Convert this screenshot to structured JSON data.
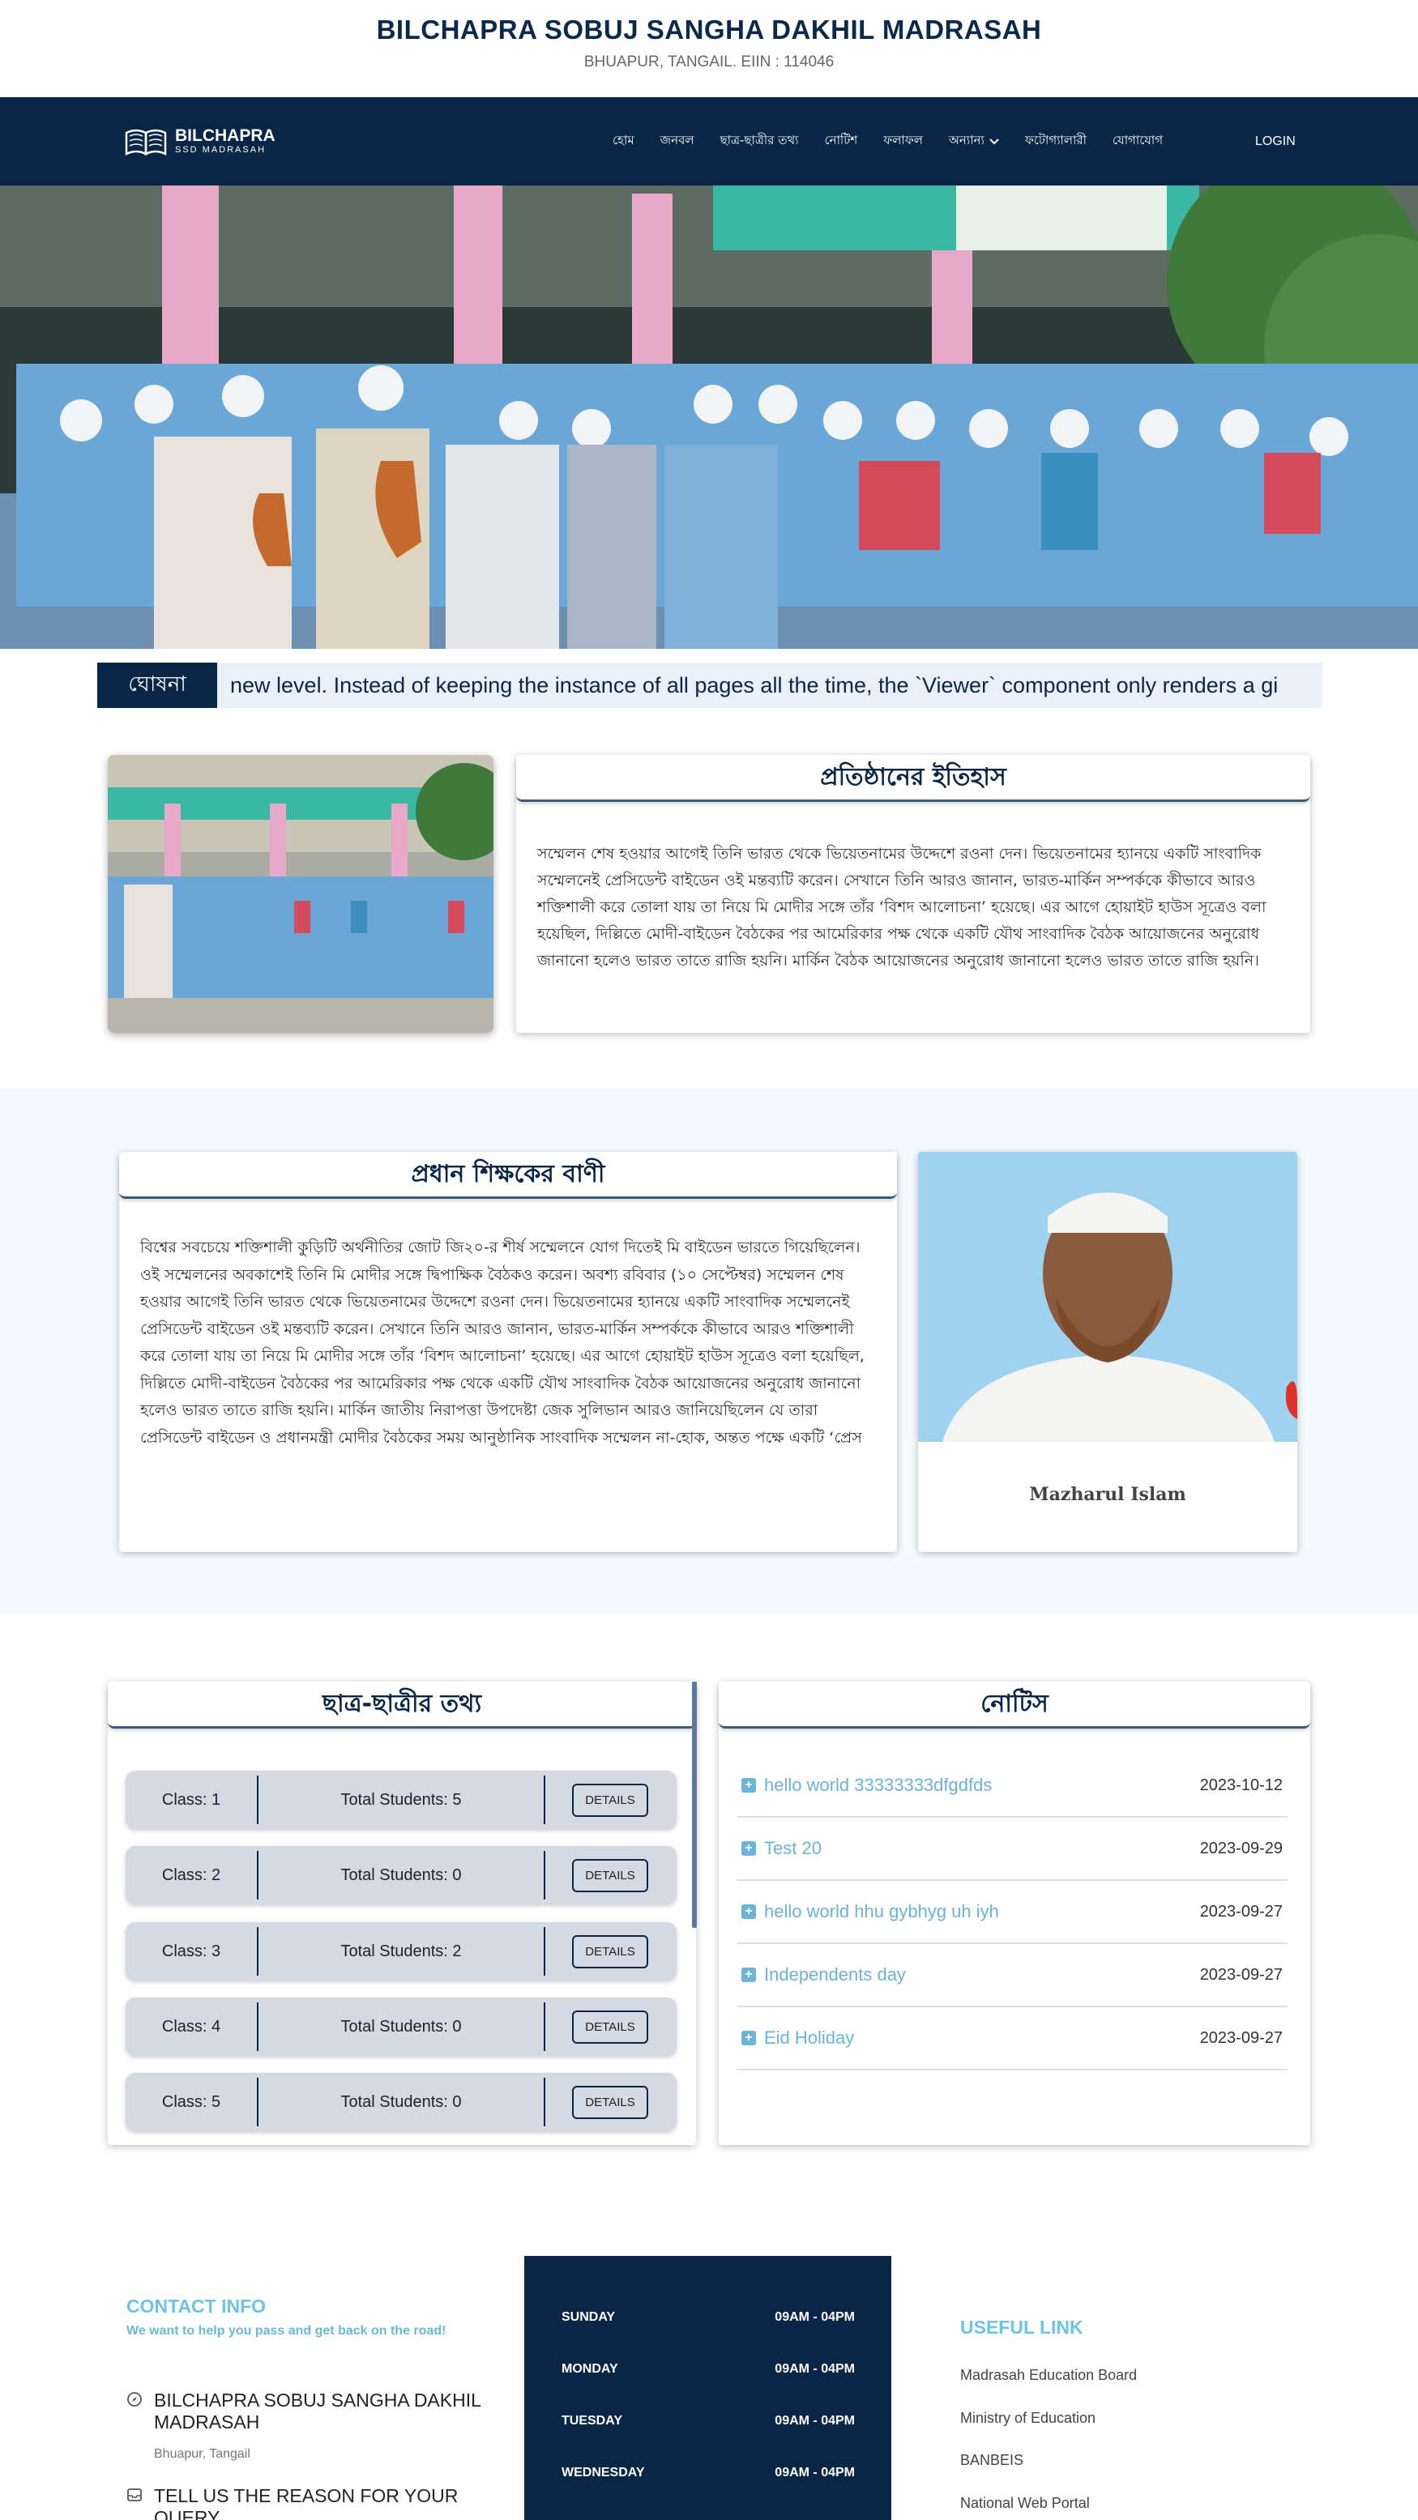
{
  "header": {
    "title": "BILCHAPRA SOBUJ SANGHA DAKHIL MADRASAH",
    "subtitle": "BHUAPUR, TANGAIL. EIIN : 114046"
  },
  "nav": {
    "logo_main": "BILCHAPRA",
    "logo_sub": "SSD MADRASAH",
    "items": [
      "হোম",
      "জনবল",
      "ছাত্র-ছাত্রীর তথ্য",
      "নোটিশ",
      "ফলাফল",
      "অন্যান্য",
      "ফটোগ্যালারী",
      "যোগাযোগ"
    ],
    "login": "LOGIN"
  },
  "announcement": {
    "label": "ঘোষনা",
    "text": "new level. Instead of keeping the instance of all pages all the time, the `Viewer` component only renders a gi"
  },
  "history": {
    "title": "প্রতিষ্ঠানের ইতিহাস",
    "body": "সম্মেলন শেষ হওয়ার আগেই তিনি ভারত থেকে ভিয়েতনামের উদ্দেশে রওনা দেন। ভিয়েতনামের হ্যানয়ে একটি সাংবাদিক সম্মেলনেই প্রেসিডেন্ট বাইডেন ওই মন্তব্যটি করেন। সেখানে তিনি আরও জানান, ভারত-মার্কিন সম্পর্ককে কীভাবে আরও শক্তিশালী করে তোলা যায় তা নিয়ে মি মোদীর সঙ্গে তাঁর ‘বিশদ আলোচনা’ হয়েছে। এর আগে হোয়াইট হাউস সূত্রেও বলা হয়েছিল, দিল্লিতে মোদী-বাইডেন বৈঠকের পর আমেরিকার পক্ষ থেকে একটি যৌথ সাংবাদিক বৈঠক আয়োজনের অনুরোধ জানানো হলেও ভারত তাতে রাজি হয়নি। মার্কিন বৈঠক আয়োজনের অনুরোধ জানানো হলেও ভারত তাতে রাজি হয়নি।"
  },
  "principal": {
    "title": "প্রধান শিক্ষকের বাণী",
    "body": "বিশ্বের সবচেয়ে শক্তিশালী কুড়িটি অর্থনীতির জোট জি২০-র শীর্ষ সম্মেলনে যোগ দিতেই মি বাইডেন ভারতে গিয়েছিলেন। ওই সম্মেলনের অবকাশেই তিনি মি মোদীর সঙ্গে দ্বিপাক্ষিক বৈঠকও করেন। অবশ্য রবিবার (১০ সেপ্টেম্বর) সম্মেলন শেষ হওয়ার আগেই তিনি ভারত থেকে ভিয়েতনামের উদ্দেশে রওনা দেন। ভিয়েতনামের হ্যানয়ে একটি সাংবাদিক সম্মেলনেই প্রেসিডেন্ট বাইডেন ওই মন্তব্যটি করেন। সেখানে তিনি আরও জানান, ভারত-মার্কিন সম্পর্ককে কীভাবে আরও শক্তিশালী করে তোলা যায় তা নিয়ে মি মোদীর সঙ্গে তাঁর ‘বিশদ আলোচনা’ হয়েছে। এর আগে হোয়াইট হাউস সূত্রেও বলা হয়েছিল, দিল্লিতে মোদী-বাইডেন বৈঠকের পর আমেরিকার পক্ষ থেকে একটি যৌথ সাংবাদিক বৈঠক আয়োজনের অনুরোধ জানানো হলেও ভারত তাতে রাজি হয়নি। মার্কিন জাতীয় নিরাপত্তা উপদেষ্টা জেক সুলিভান আরও জানিয়েছিলেন যে তারা প্রেসিডেন্ট বাইডেন ও প্রধানমন্ত্রী মোদীর বৈঠকের সময় আনুষ্ঠানিক সাংবাদিক সম্মেলন না-হোক, অন্তত পক্ষে একটি ‘প্রেস",
    "name": "Mazharul Islam"
  },
  "students": {
    "title": "ছাত্র-ছাত্রীর তথ্য",
    "rows": [
      {
        "class": "Class: 1",
        "total": "Total Students: 5",
        "button": "DETAILS"
      },
      {
        "class": "Class: 2",
        "total": "Total Students: 0",
        "button": "DETAILS"
      },
      {
        "class": "Class: 3",
        "total": "Total Students: 2",
        "button": "DETAILS"
      },
      {
        "class": "Class: 4",
        "total": "Total Students: 0",
        "button": "DETAILS"
      },
      {
        "class": "Class: 5",
        "total": "Total Students: 0",
        "button": "DETAILS"
      }
    ]
  },
  "notice": {
    "title": "নোটিস",
    "items": [
      {
        "title": "hello world 33333333dfgdfds",
        "date": "2023-10-12"
      },
      {
        "title": "Test 20",
        "date": "2023-09-29"
      },
      {
        "title": "hello world hhu gybhyg uh iyh",
        "date": "2023-09-27"
      },
      {
        "title": "Independents day",
        "date": "2023-09-27"
      },
      {
        "title": "Eid Holiday",
        "date": "2023-09-27"
      }
    ]
  },
  "footer": {
    "contact_title": "CONTACT INFO",
    "contact_sub": "We want to help you pass and get back on the road!",
    "address_name": "BILCHAPRA SOBUJ SANGHA DAKHIL MADRASAH",
    "address_place": "Bhuapur, Tangail",
    "query": "TELL US THE REASON FOR YOUR QUERY",
    "hours": [
      {
        "day": "SUNDAY",
        "time": "09AM - 04PM"
      },
      {
        "day": "MONDAY",
        "time": "09AM - 04PM"
      },
      {
        "day": "TUESDAY",
        "time": "09AM - 04PM"
      },
      {
        "day": "WEDNESDAY",
        "time": "09AM - 04PM"
      }
    ],
    "useful_title": "USEFUL LINK",
    "useful_links": [
      "Madrasah Education Board",
      "Ministry of Education",
      "BANBEIS",
      "National Web Portal"
    ]
  }
}
